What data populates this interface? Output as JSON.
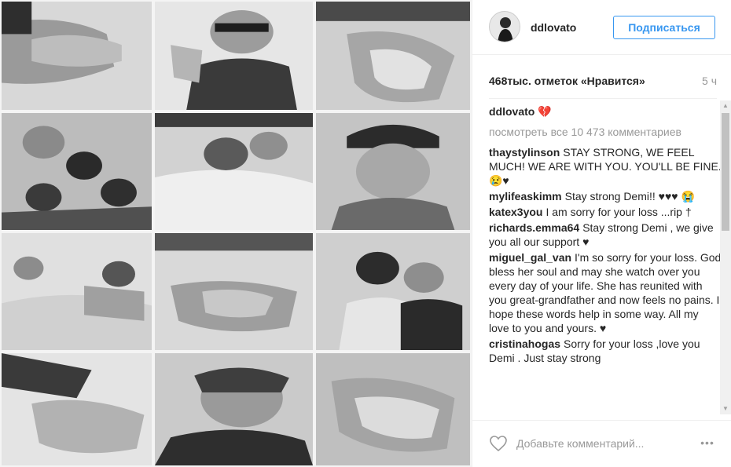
{
  "post": {
    "image_alt": "photo collage"
  },
  "header": {
    "username": "ddlovato",
    "follow_label": "Подписаться"
  },
  "stats": {
    "likes": "468тыс. отметок «Нравится»",
    "time": "5 ч"
  },
  "caption": {
    "user": "ddlovato",
    "text": "💔"
  },
  "view_all_comments": "посмотреть все 10 473 комментариев",
  "comments": [
    {
      "user": "thaystylinson",
      "text": "STAY STRONG, WE FEEL MUCH! WE ARE WITH YOU. YOU'LL BE FINE. 😢♥"
    },
    {
      "user": "mylifeaskimm",
      "text": "Stay strong Demi!! ♥♥♥ 😭"
    },
    {
      "user": "katex3you",
      "text": "I am sorry for your loss ...rip †"
    },
    {
      "user": "richards.emma64",
      "text": "Stay strong Demi , we give you all our support ♥"
    },
    {
      "user": "miguel_gal_van",
      "text": "I'm so sorry for your loss. God bless her soul and may she watch over you every day of your life. She has reunited with you great-grandfather and now feels no pains. I hope these words help in some way. All my love to you and yours. ♥"
    },
    {
      "user": "cristinahogas",
      "text": "Sorry for your loss ,love you Demi . Just stay strong"
    }
  ],
  "add_comment": {
    "placeholder": "Добавьте комментарий...",
    "more": "•••"
  },
  "scrollbar": {
    "up": "▲",
    "down": "▼"
  }
}
